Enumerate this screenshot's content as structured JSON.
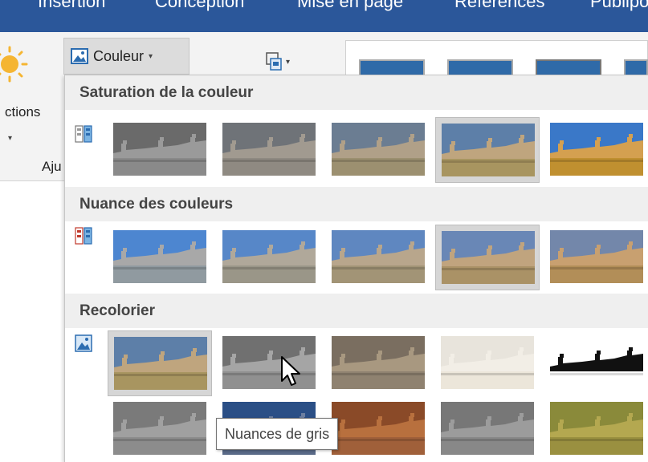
{
  "ribbon_tabs": [
    "Insertion",
    "Conception",
    "Mise en page",
    "Références",
    "Publipo"
  ],
  "ribbon": {
    "corrections_label": "ctions",
    "ajuster_label": "Aju",
    "couleur_button": {
      "label": "Couleur",
      "icon": "picture-color-icon"
    },
    "artistic_effects_icon": "artistic-effects-icon"
  },
  "menu": {
    "sections": [
      {
        "title": "Saturation de la couleur",
        "icon": "saturation-icon",
        "selected_index": 3
      },
      {
        "title": "Nuance des couleurs",
        "icon": "tone-icon",
        "selected_index": 3
      },
      {
        "title": "Recolorier",
        "icon": "recolor-icon",
        "selected_index": 0
      }
    ],
    "tooltip": "Nuances de gris"
  },
  "colors": {
    "ribbon_blue": "#2b579a",
    "ribbon_bg": "#f3f3f3",
    "selected_cell": "#d6d6d6"
  }
}
